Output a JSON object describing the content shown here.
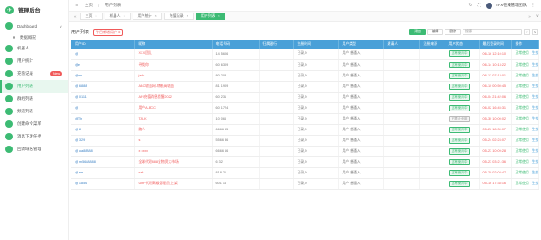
{
  "app": {
    "brand": "管理后台"
  },
  "sidebar": {
    "items": [
      {
        "label": "Dashboard",
        "icon": "dashboard-icon",
        "color": "#3dbb74",
        "caret": "∨"
      },
      {
        "label": "数据概况",
        "sub": true
      },
      {
        "label": "机器人",
        "icon": "robot-icon",
        "color": "#3dbb74"
      },
      {
        "label": "用户统计",
        "icon": "chart-icon",
        "color": "#3dbb74",
        "badge": ""
      },
      {
        "label": "充值记录",
        "icon": "pay-icon",
        "color": "#3dbb74",
        "badge": "New"
      },
      {
        "label": "用户列表",
        "icon": "users-icon",
        "color": "#3dbb74",
        "active": true
      },
      {
        "label": "群组列表",
        "icon": "group-icon",
        "color": "#3dbb74"
      },
      {
        "label": "频道列表",
        "icon": "channel-icon",
        "color": "#3dbb74"
      },
      {
        "label": "创建命令菜单",
        "icon": "menu-icon",
        "color": "#3dbb74"
      },
      {
        "label": "消息下发任务",
        "icon": "task-icon",
        "color": "#3dbb74"
      },
      {
        "label": "回调域名管理",
        "icon": "domain-icon",
        "color": "#3dbb74"
      }
    ]
  },
  "topbar": {
    "crumbs": [
      "主页",
      "用户列表"
    ],
    "user_name": "TRX在线管理团队"
  },
  "tabs": [
    {
      "label": "主页"
    },
    {
      "label": "机器人"
    },
    {
      "label": "用户统计"
    },
    {
      "label": "充值记录"
    },
    {
      "label": "用户列表",
      "active": true
    }
  ],
  "toolbar": {
    "title": "用户列表",
    "subtitle": "今日新增用户 5",
    "btn_add": "添加",
    "btn_edit": "编辑",
    "btn_delete": "删除",
    "search_placeholder": "搜索",
    "btn_search": "⌕",
    "btn_refresh": "↻"
  },
  "table": {
    "columns": [
      "用户ID",
      "昵称",
      "电话号码",
      "归属银行",
      "注册时间",
      "用户类型",
      "邀请人",
      "注册来源",
      "用户状态",
      "最后登录时间",
      "操作"
    ],
    "rows": [
      {
        "id": "@          ",
        "name": "XXX团队",
        "phone": "14         5606",
        "bank": "",
        "reg": "已录入",
        "type": "用户 普通入",
        "inviter": "",
        "status": "正常使用中",
        "status_grey": false,
        "time": "06-16 12:10:10",
        "actions": [
          "正常使用",
          "生效完成"
        ]
      },
      {
        "id": "@e          ",
        "name": "寻找你",
        "phone": "60         6309",
        "bank": "",
        "reg": "已录入",
        "type": "用户 普通入",
        "inviter": "",
        "status": "正常使用中",
        "status_grey": false,
        "time": "06-14 10:13:22",
        "actions": [
          "正常使用",
          "生效完成"
        ]
      },
      {
        "id": "@an          ",
        "name": "jack",
        "phone": "80         203",
        "bank": "",
        "reg": "已录入",
        "type": "用户 普通入",
        "inviter": "",
        "status": "正常使用中",
        "status_grey": false,
        "time": "06-12 07:13:01",
        "actions": [
          "正常使用",
          "生效完成"
        ]
      },
      {
        "id": "@       6888",
        "name": "ABC收益网-转账高收益",
        "phone": "81         1909",
        "bank": "",
        "reg": "已录入",
        "type": "用户 普通入",
        "inviter": "",
        "status": "正常使用中",
        "status_grey": false,
        "time": "06-10 00:50:45",
        "actions": [
          "正常使用",
          "生效完成"
        ]
      },
      {
        "id": "@          0111",
        "name": "API充值消息提醒2022",
        "phone": "60         231",
        "bank": "",
        "reg": "已录入",
        "type": "用户 普通入",
        "inviter": "",
        "status": "正常使用中",
        "status_grey": false,
        "time": "06-04 21:42:06",
        "actions": [
          "正常使用",
          "生效完成"
        ]
      },
      {
        "id": "@          ",
        "name": "用户A-BCC",
        "phone": "60         1724",
        "bank": "",
        "reg": "已录入",
        "type": "用户 普通入",
        "inviter": "",
        "status": "正常使用中",
        "status_grey": false,
        "time": "06-02 16:45:31",
        "actions": [
          "正常使用",
          "生效完成"
        ]
      },
      {
        "id": "@Th          ",
        "name": "TALK",
        "phone": "10         066",
        "bank": "",
        "reg": "已录入",
        "type": "用户 普通入",
        "inviter": "",
        "status": "已禁止使用",
        "status_grey": true,
        "time": "05-30 10:00:02",
        "actions": [
          "正常使用",
          "生效完成"
        ]
      },
      {
        "id": "@           8",
        "name": "路人",
        "phone": "6666         55",
        "bank": "",
        "reg": "已录入",
        "type": "用户 普通入",
        "inviter": "",
        "status": "正常使用中",
        "status_grey": false,
        "time": "05-26 18:30:07",
        "actions": [
          "正常使用",
          "生效完成"
        ]
      },
      {
        "id": "@          329",
        "name": "s",
        "phone": "5566         36",
        "bank": "",
        "reg": "已录入",
        "type": "用户 普通入",
        "inviter": "",
        "status": "正常使用中",
        "status_grey": false,
        "time": "05-24 02:24:07",
        "actions": [
          "正常使用",
          "生效完成"
        ]
      },
      {
        "id": "@          ua88888",
        "name": "x xxxx",
        "phone": "6666         66",
        "bank": "",
        "reg": "已录入",
        "type": "用户 普通入",
        "inviter": "",
        "status": "正常使用中",
        "status_grey": false,
        "time": "05-23 10:09:28",
        "actions": [
          "正常使用",
          "生效完成"
        ]
      },
      {
        "id": "@          m5688888",
        "name": "全球代理888全物资大市场",
        "phone": "6         32",
        "bank": "",
        "reg": "已录入",
        "type": "用户 普通入",
        "inviter": "",
        "status": "正常使用中",
        "status_grey": false,
        "time": "05-23 03:21:36",
        "actions": [
          "正常使用",
          "生效完成"
        ]
      },
      {
        "id": "@          ee",
        "name": "salt",
        "phone": "818         21",
        "bank": "",
        "reg": "已录入",
        "type": "用户 普通入",
        "inviter": "",
        "status": "正常使用中",
        "status_grey": false,
        "time": "05-20 02:08:47",
        "actions": [
          "正常使用",
          "生效完成"
        ]
      },
      {
        "id": "@          1856",
        "name": "UHF代理高级管理员(上架",
        "phone": "601         16",
        "bank": "",
        "reg": "已录入",
        "type": "用户 普通入",
        "inviter": "",
        "status": "正常使用中",
        "status_grey": false,
        "time": "05-16 17:38:16",
        "actions": [
          "正常使用",
          "生效完成"
        ]
      }
    ]
  }
}
